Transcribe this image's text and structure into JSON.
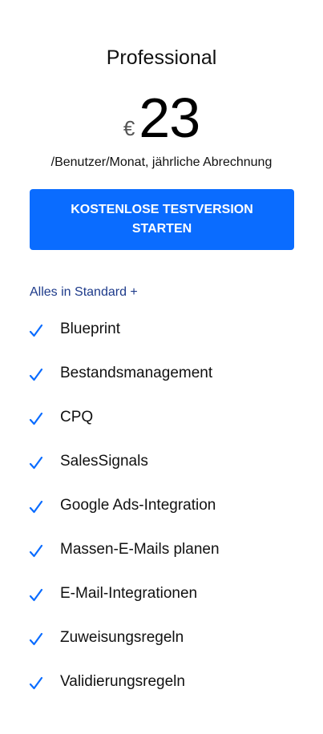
{
  "plan": {
    "title": "Professional",
    "currency": "€",
    "price": "23",
    "price_note": "/Benutzer/Monat, jährliche Abrechnung",
    "cta_label": "KOSTENLOSE TESTVERSION STARTEN",
    "includes_prefix": "Alles in ",
    "includes_link": "Standard",
    "includes_suffix": " +"
  },
  "features": [
    "Blueprint",
    "Bestandsmanagement",
    "CPQ",
    "SalesSignals",
    "Google Ads-Integration",
    "Massen-E-Mails planen",
    "E-Mail-Integrationen",
    "Zuweisungsregeln",
    "Validierungsregeln"
  ],
  "colors": {
    "accent": "#0a6cff",
    "link": "#1d3a8a",
    "check": "#0a6cff"
  },
  "icons": {
    "feature_check": "check-icon"
  }
}
